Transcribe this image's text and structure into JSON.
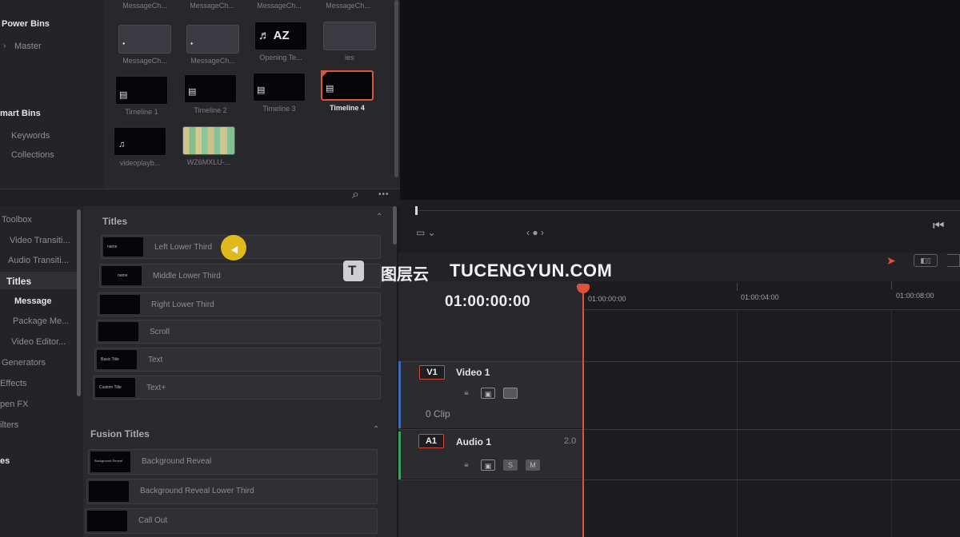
{
  "media_pool": {
    "sidebar": {
      "power_bins_label": "Power Bins",
      "master_label": "Master",
      "smart_bins_label": "mart Bins",
      "keywords_label": "Keywords",
      "collections_label": "Collections"
    },
    "clips_row0": [
      "MessageCh...",
      "MessageCh...",
      "MessageCh...",
      "MessageCh..."
    ],
    "clips": [
      {
        "name": "MessageCh...",
        "glyph": "⬩"
      },
      {
        "name": "MessageCh...",
        "glyph": "⬩"
      },
      {
        "name": "Opening Te...",
        "glyph": "♬ AZ"
      },
      {
        "name": "ies",
        "glyph": ""
      },
      {
        "name": "Timeline 1",
        "glyph": "▤"
      },
      {
        "name": "Timeline 2",
        "glyph": "▤"
      },
      {
        "name": "Timeline 3",
        "glyph": "▤"
      },
      {
        "name": "Timeline 4",
        "glyph": "▤"
      },
      {
        "name": "videoplayb...",
        "glyph": "♫"
      },
      {
        "name": "WZ6MXLU-...",
        "glyph": ""
      }
    ]
  },
  "toolbar": {
    "search_icon": "search-icon",
    "more_icon": "more-icon",
    "search_glyph": "⌕",
    "more_glyph": "•••"
  },
  "effects_sidebar": {
    "items": [
      "Toolbox",
      "Video Transiti...",
      "Audio Transiti...",
      "Titles",
      "Message",
      "Package Me...",
      "Video Editor...",
      "Generators",
      "Effects",
      "pen FX",
      "ilters",
      "es"
    ]
  },
  "titles_panel": {
    "section_titles": "Titles",
    "titles": [
      {
        "label": "Left Lower Third",
        "thumb": "name"
      },
      {
        "label": "Middle Lower Third",
        "thumb": "name"
      },
      {
        "label": "Right Lower Third",
        "thumb": ""
      },
      {
        "label": "Scroll",
        "thumb": ""
      },
      {
        "label": "Text",
        "thumb": "Basic Title"
      },
      {
        "label": "Text+",
        "thumb": "Custom Title"
      }
    ],
    "section_fusion": "Fusion Titles",
    "fusion_titles": [
      {
        "label": "Background Reveal",
        "thumb": "Background Reveal"
      },
      {
        "label": "Background Reveal Lower Third",
        "thumb": ""
      },
      {
        "label": "Call Out",
        "thumb": ""
      }
    ],
    "collapse_glyph": "⌃"
  },
  "viewer_controls": {
    "pager": "‹ ● ›",
    "skip_start": "⏮",
    "layout_glyph": "▭ ⌄"
  },
  "timeline": {
    "timecode": "01:00:00:00",
    "ruler_ticks": [
      "01:00:00:00",
      "01:00:04:00",
      "01:00:08:00"
    ],
    "tools_glyph": "▸ ◧ ◫",
    "tracks": {
      "video": {
        "id": "V1",
        "name": "Video 1",
        "clip_count": "0 Clip"
      },
      "audio": {
        "id": "A1",
        "name": "Audio 1",
        "level": "2.0",
        "solo": "S",
        "mute": "M"
      }
    }
  },
  "watermark": {
    "badge": "T",
    "cn": "图层云",
    "en": "TUCENGYUN.COM"
  },
  "colors": {
    "accent": "#e0513a",
    "highlight_cursor": "#e8c21c",
    "video_track": "#3e6ab5",
    "audio_track": "#3ea05a"
  }
}
